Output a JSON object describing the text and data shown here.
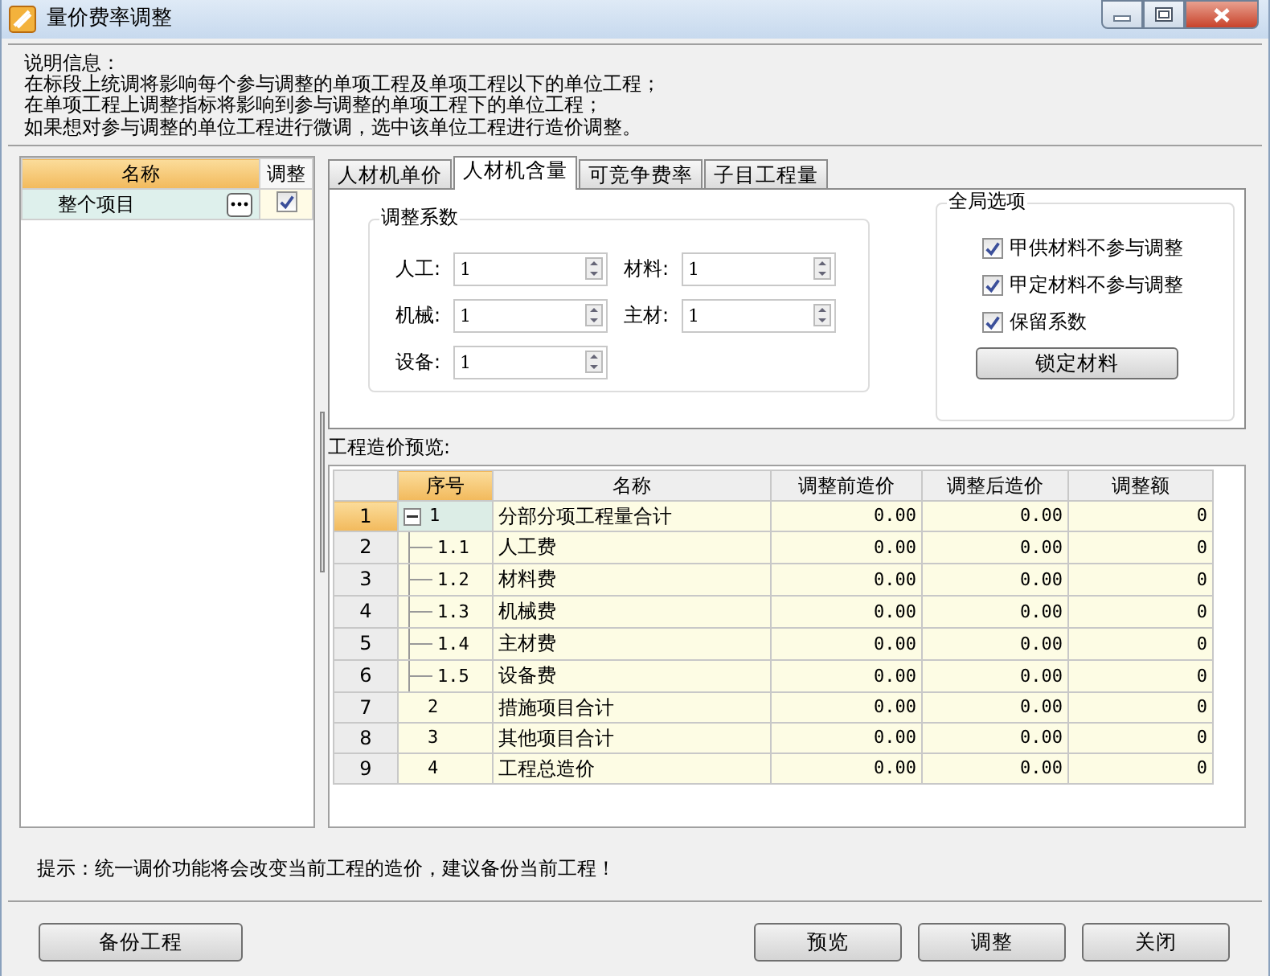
{
  "window": {
    "title": "量价费率调整"
  },
  "info": {
    "lines": [
      "说明信息：",
      "在标段上统调将影响每个参与调整的单项工程及单项工程以下的单位工程；",
      "在单项工程上调整指标将影响到参与调整的单项工程下的单位工程；",
      "如果想对参与调整的单位工程进行微调，选中该单位工程进行造价调整。"
    ]
  },
  "project_tree": {
    "columns": [
      "名称",
      "调整"
    ],
    "items": [
      {
        "name": "整个项目",
        "checked": true,
        "selected": true
      }
    ]
  },
  "tabs": [
    {
      "label": "人材机单价",
      "selected": false
    },
    {
      "label": "人材机含量",
      "selected": true
    },
    {
      "label": "可竞争费率",
      "selected": false
    },
    {
      "label": "子目工程量",
      "selected": false
    }
  ],
  "coefficients": {
    "title": "调整系数",
    "fields": [
      {
        "label": "人工:",
        "value": "1"
      },
      {
        "label": "材料:",
        "value": "1"
      },
      {
        "label": "机械:",
        "value": "1"
      },
      {
        "label": "主材:",
        "value": "1"
      },
      {
        "label": "设备:",
        "value": "1"
      }
    ]
  },
  "global_options": {
    "title": "全局选项",
    "options": [
      {
        "label": "甲供材料不参与调整",
        "checked": true
      },
      {
        "label": "甲定材料不参与调整",
        "checked": true
      },
      {
        "label": "保留系数",
        "checked": true
      }
    ],
    "button": "锁定材料"
  },
  "preview": {
    "title": "工程造价预览:",
    "columns": [
      "序号",
      "名称",
      "调整前造价",
      "调整后造价",
      "调整额"
    ],
    "rows": [
      {
        "row_number": "1",
        "seq": "1",
        "name": "分部分项工程量合计",
        "before": "0.00",
        "after": "0.00",
        "change": "0",
        "selected": true,
        "expanded": true,
        "children": [
          {
            "row_number": "2",
            "seq": "1.1",
            "name": "人工费",
            "before": "0.00",
            "after": "0.00",
            "change": "0",
            "selected": false
          },
          {
            "row_number": "3",
            "seq": "1.2",
            "name": "材料费",
            "before": "0.00",
            "after": "0.00",
            "change": "0",
            "selected": false
          },
          {
            "row_number": "4",
            "seq": "1.3",
            "name": "机械费",
            "before": "0.00",
            "after": "0.00",
            "change": "0",
            "selected": false
          },
          {
            "row_number": "5",
            "seq": "1.4",
            "name": "主材费",
            "before": "0.00",
            "after": "0.00",
            "change": "0",
            "selected": false
          },
          {
            "row_number": "6",
            "seq": "1.5",
            "name": "设备费",
            "before": "0.00",
            "after": "0.00",
            "change": "0",
            "selected": false
          }
        ]
      },
      {
        "row_number": "7",
        "seq": "2",
        "name": "措施项目合计",
        "before": "0.00",
        "after": "0.00",
        "change": "0",
        "selected": false
      },
      {
        "row_number": "8",
        "seq": "3",
        "name": "其他项目合计",
        "before": "0.00",
        "after": "0.00",
        "change": "0",
        "selected": false
      },
      {
        "row_number": "9",
        "seq": "4",
        "name": "工程总造价",
        "before": "0.00",
        "after": "0.00",
        "change": "0",
        "selected": false
      }
    ]
  },
  "hint": "提示：统一调价功能将会改变当前工程的造价，建议备份当前工程！",
  "left_buttons": [
    "备份工程"
  ],
  "right_buttons": [
    "预览",
    "调整",
    "关闭"
  ]
}
